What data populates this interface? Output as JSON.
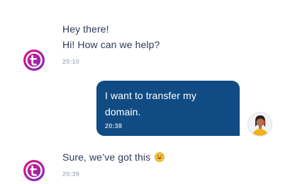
{
  "chat": {
    "group1": {
      "messages": [
        "Hey there!",
        "Hi! How can we help?"
      ],
      "time": "20:10"
    },
    "user_message": {
      "line1": "I want to transfer my",
      "line2": "domain.",
      "time": "20:38"
    },
    "group2": {
      "message": "Sure, we’ve got this",
      "time": "20:39"
    }
  },
  "colors": {
    "brand_gradient_start": "#e0197a",
    "brand_gradient_end": "#7a2bc4",
    "user_bubble": "#114b84",
    "text": "#2f3a55",
    "timestamp": "#b3b8c3"
  },
  "icons": {
    "agent_avatar": "brand-logo-t",
    "user_avatar": "user-avatar-photo",
    "emoji": "smiling-face-emoji"
  }
}
